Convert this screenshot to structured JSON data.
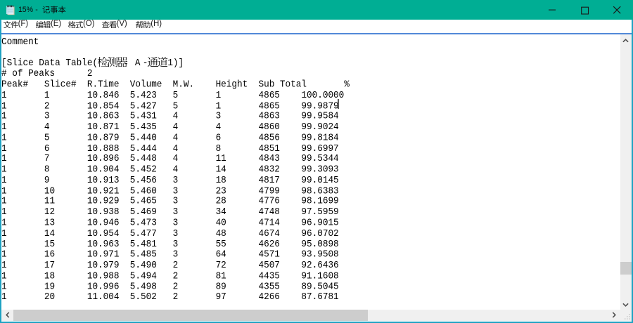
{
  "window": {
    "app": "记事本",
    "title": "15% - 记事本"
  },
  "titlebar": {
    "icon": "notepad-icon",
    "title_prefix": "15%",
    "title_dash": "-",
    "title_app": "记事本",
    "buttons": {
      "minimize": "minimize",
      "maximize": "maximize",
      "close": "close"
    }
  },
  "menubar": {
    "items": [
      {
        "label": "文件(F)",
        "cjk": "文件",
        "accel": "(F)"
      },
      {
        "label": "编辑(E)",
        "cjk": "编辑",
        "accel": "(E)"
      },
      {
        "label": "格式(O)",
        "cjk": "格式",
        "accel": "(O)"
      },
      {
        "label": "查看(V)",
        "cjk": "查看",
        "accel": "(V)"
      },
      {
        "label": "帮助(H)",
        "cjk": "帮助",
        "accel": "(H)"
      }
    ]
  },
  "editor": {
    "comment": "Comment",
    "section_line": {
      "full": "[Slice Data Table(检测器 A-通道1)]",
      "pre": "[Slice Data Table(",
      "cjk1": "检测器",
      "space": " ",
      "wide_char": "A",
      "hyphen": "-",
      "cjk2": "通道",
      "post": "1)]"
    },
    "peaks_label": "# of Peaks",
    "peaks_value": "2",
    "columns": [
      "Peak#",
      "Slice#",
      "R.Time",
      "Volume",
      "M.W.",
      "Height",
      "Sub Total",
      "%"
    ],
    "rows": [
      [
        "1",
        "1",
        "10.846",
        "5.423",
        "5",
        "1",
        "4865",
        "100.0000"
      ],
      [
        "1",
        "2",
        "10.854",
        "5.427",
        "5",
        "1",
        "4865",
        "99.9879"
      ],
      [
        "1",
        "3",
        "10.863",
        "5.431",
        "4",
        "3",
        "4863",
        "99.9584"
      ],
      [
        "1",
        "4",
        "10.871",
        "5.435",
        "4",
        "4",
        "4860",
        "99.9024"
      ],
      [
        "1",
        "5",
        "10.879",
        "5.440",
        "4",
        "6",
        "4856",
        "99.8184"
      ],
      [
        "1",
        "6",
        "10.888",
        "5.444",
        "4",
        "8",
        "4851",
        "99.6997"
      ],
      [
        "1",
        "7",
        "10.896",
        "5.448",
        "4",
        "11",
        "4843",
        "99.5344"
      ],
      [
        "1",
        "8",
        "10.904",
        "5.452",
        "4",
        "14",
        "4832",
        "99.3093"
      ],
      [
        "1",
        "9",
        "10.913",
        "5.456",
        "3",
        "18",
        "4817",
        "99.0145"
      ],
      [
        "1",
        "10",
        "10.921",
        "5.460",
        "3",
        "23",
        "4799",
        "98.6383"
      ],
      [
        "1",
        "11",
        "10.929",
        "5.465",
        "3",
        "28",
        "4776",
        "98.1699"
      ],
      [
        "1",
        "12",
        "10.938",
        "5.469",
        "3",
        "34",
        "4748",
        "97.5959"
      ],
      [
        "1",
        "13",
        "10.946",
        "5.473",
        "3",
        "40",
        "4714",
        "96.9015"
      ],
      [
        "1",
        "14",
        "10.954",
        "5.477",
        "3",
        "48",
        "4674",
        "96.0702"
      ],
      [
        "1",
        "15",
        "10.963",
        "5.481",
        "3",
        "55",
        "4626",
        "95.0898"
      ],
      [
        "1",
        "16",
        "10.971",
        "5.485",
        "3",
        "64",
        "4571",
        "93.9508"
      ],
      [
        "1",
        "17",
        "10.979",
        "5.490",
        "2",
        "72",
        "4507",
        "92.6436"
      ],
      [
        "1",
        "18",
        "10.988",
        "5.494",
        "2",
        "81",
        "4435",
        "91.1608"
      ],
      [
        "1",
        "19",
        "10.996",
        "5.498",
        "2",
        "89",
        "4355",
        "89.5045"
      ],
      [
        "1",
        "20",
        "11.004",
        "5.502",
        "2",
        "97",
        "4266",
        "87.6781"
      ]
    ],
    "caret": {
      "visible": true,
      "after": "99.9879"
    }
  },
  "colors": {
    "titlebar": "#00AE94",
    "window_border": "#1EA2C2",
    "menu_rule": "#5289D8",
    "scroll_track": "#F0F0F0",
    "scroll_thumb": "#CDCDCD",
    "scroll_arrow": "#4F4F4F",
    "text": "#000000"
  }
}
